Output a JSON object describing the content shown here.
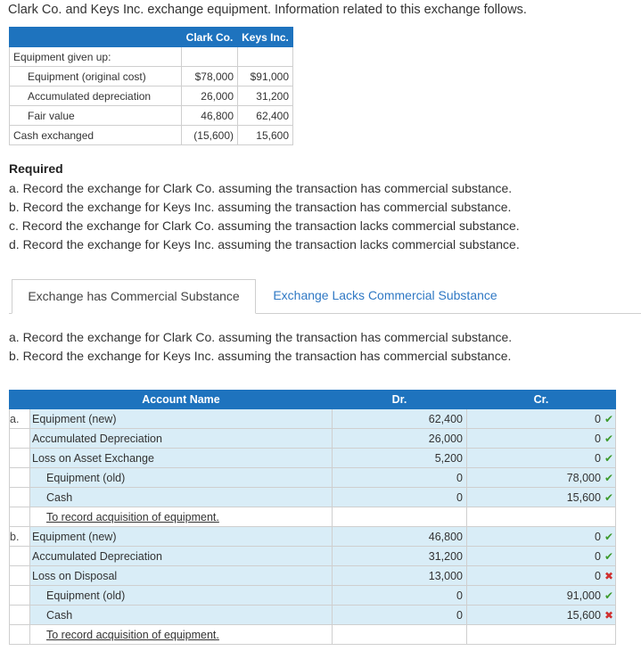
{
  "intro": "Clark Co. and Keys Inc. exchange equipment. Information related to this exchange follows.",
  "info": {
    "headers": [
      "Clark Co.",
      "Keys Inc."
    ],
    "rows": [
      {
        "label": "Equipment given up:",
        "clark": "",
        "keys": ""
      },
      {
        "label": "Equipment (original cost)",
        "clark": "$78,000",
        "keys": "$91,000"
      },
      {
        "label": "Accumulated depreciation",
        "clark": "26,000",
        "keys": "31,200"
      },
      {
        "label": "Fair value",
        "clark": "46,800",
        "keys": "62,400"
      },
      {
        "label": "Cash exchanged",
        "clark": "(15,600)",
        "keys": "15,600"
      }
    ]
  },
  "required": {
    "title": "Required",
    "items": [
      "a. Record the exchange for Clark Co. assuming the transaction has commercial substance.",
      "b. Record the exchange for Keys Inc. assuming the transaction has commercial substance.",
      "c. Record the exchange for Clark Co. assuming the transaction lacks commercial substance.",
      "d. Record the exchange for Keys Inc. assuming the transaction lacks commercial substance."
    ]
  },
  "tabs": [
    {
      "label": "Exchange has Commercial Substance",
      "active": true
    },
    {
      "label": "Exchange Lacks Commercial Substance",
      "active": false
    }
  ],
  "subtext": [
    "a. Record the exchange for Clark Co. assuming the transaction has commercial substance.",
    "b. Record the exchange for Keys Inc. assuming the transaction has commercial substance."
  ],
  "journal": {
    "headers": {
      "account": "Account Name",
      "dr": "Dr.",
      "cr": "Cr."
    },
    "entries": [
      {
        "letter": "a.",
        "lines": [
          {
            "account": "Equipment (new)",
            "dr": "62,400",
            "cr": "0",
            "mark": "check"
          },
          {
            "account": "Accumulated Depreciation",
            "dr": "26,000",
            "cr": "0",
            "mark": "check"
          },
          {
            "account": "Loss on Asset Exchange",
            "dr": "5,200",
            "cr": "0",
            "mark": "check"
          },
          {
            "account": "Equipment (old)",
            "dr": "0",
            "cr": "78,000",
            "mark": "check"
          },
          {
            "account": "Cash",
            "dr": "0",
            "cr": "15,600",
            "mark": "check"
          }
        ],
        "note": "To record acquisition of equipment."
      },
      {
        "letter": "b.",
        "lines": [
          {
            "account": "Equipment (new)",
            "dr": "46,800",
            "cr": "0",
            "mark": "check"
          },
          {
            "account": "Accumulated Depreciation",
            "dr": "31,200",
            "cr": "0",
            "mark": "check"
          },
          {
            "account": "Loss on Disposal",
            "dr": "13,000",
            "cr": "0",
            "mark": "cross"
          },
          {
            "account": "Equipment (old)",
            "dr": "0",
            "cr": "91,000",
            "mark": "check"
          },
          {
            "account": "Cash",
            "dr": "0",
            "cr": "15,600",
            "mark": "cross"
          }
        ],
        "note": "To record acquisition of equipment."
      }
    ]
  },
  "colors": {
    "header_blue": "#1e73be",
    "cell_blue": "#d9edf7",
    "link_blue": "#2f78c4",
    "check_green": "#3c9a2c",
    "cross_red": "#d0302f"
  }
}
